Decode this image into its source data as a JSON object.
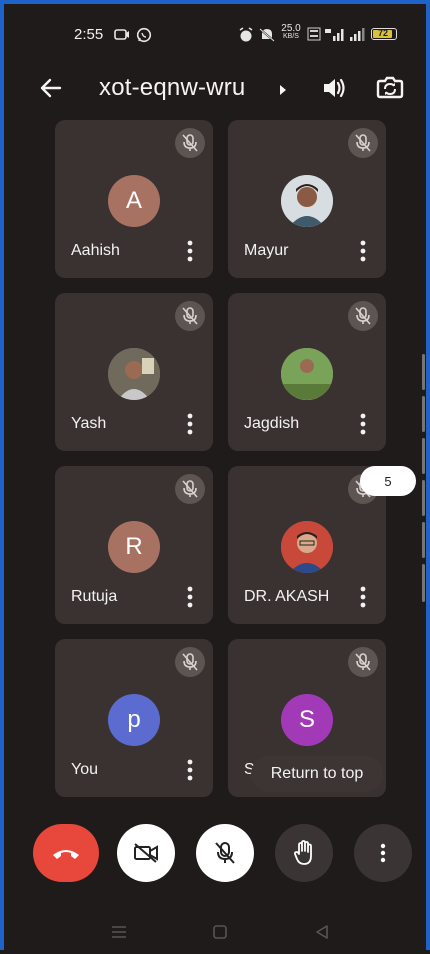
{
  "status_bar": {
    "time": "2:55",
    "network_speed_value": "25.0",
    "network_speed_unit": "KB/S",
    "battery": "72"
  },
  "header": {
    "meeting_code": "xot-eqnw-wru"
  },
  "participants": [
    {
      "name": "Aahish",
      "initial": "A",
      "avatar_color": "#a87263",
      "muted": true
    },
    {
      "name": "Mayur",
      "initial": "",
      "avatar_color": "#6c8a9a",
      "muted": true
    },
    {
      "name": "Yash",
      "initial": "",
      "avatar_color": "#8a7a6a",
      "muted": true
    },
    {
      "name": "Jagdish",
      "initial": "",
      "avatar_color": "#9aa27a",
      "muted": true
    },
    {
      "name": "Rutuja",
      "initial": "R",
      "avatar_color": "#a87263",
      "muted": true
    },
    {
      "name": "DR. AKASH",
      "initial": "",
      "avatar_color": "#c8483a",
      "muted": true
    },
    {
      "name": "You",
      "initial": "p",
      "avatar_color": "#5b6bd0",
      "muted": true
    },
    {
      "name": "Sh",
      "initial": "S",
      "avatar_color": "#a23ab8",
      "muted": true
    }
  ],
  "page_indicator": "5",
  "return_to_top_label": "Return to top",
  "colors": {
    "end_call": "#e8473b",
    "tile_bg": "#3a3230",
    "background": "#1f1b1a",
    "control_light": "#ffffff",
    "control_dark": "#3a3534"
  },
  "icons": {
    "back": "arrow-left-icon",
    "speaker": "speaker-icon",
    "switch_camera": "switch-camera-icon",
    "mute": "mic-off-icon",
    "more": "more-vert-icon",
    "end_call": "phone-hangup-icon",
    "camera_off": "videocam-off-icon",
    "raise_hand": "hand-icon"
  }
}
